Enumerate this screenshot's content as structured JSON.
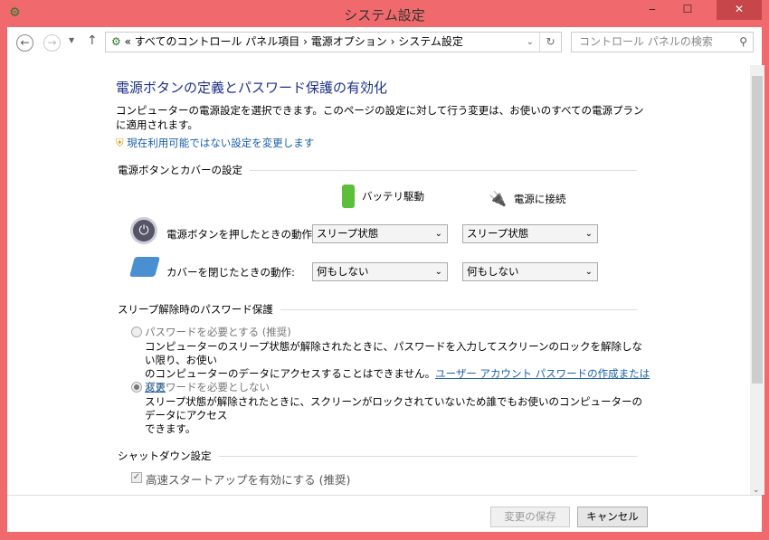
{
  "window": {
    "title": "システム設定",
    "minimize": "‒",
    "maximize": "☐",
    "close": "✕"
  },
  "nav": {
    "breadcrumb_prefix": "«",
    "crumbs": [
      "すべてのコントロール パネル項目",
      "電源オプション",
      "システム設定"
    ],
    "sep": "›",
    "search_placeholder": "コントロール パネルの検索"
  },
  "main": {
    "heading": "電源ボタンの定義とパスワード保護の有効化",
    "description": "コンピューターの電源設定を選択できます。このページの設定に対して行う変更は、お使いのすべての電源プランに適用されます。",
    "admin_link": "現在利用可能ではない設定を変更します",
    "section_power": "電源ボタンとカバーの設定",
    "col_battery": "バッテリ駆動",
    "col_plugged": "電源に接続",
    "rows": [
      {
        "label": "電源ボタンを押したときの動作:",
        "battery": "スリープ状態",
        "plugged": "スリープ状態"
      },
      {
        "label": "カバーを閉じたときの動作:",
        "battery": "何もしない",
        "plugged": "何もしない"
      }
    ],
    "section_password": "スリープ解除時のパスワード保護",
    "opt_require": "パスワードを必要とする (推奨)",
    "opt_require_desc1": "コンピューターのスリープ状態が解除されたときに、パスワードを入力してスクリーンのロックを解除しない限り、お使い",
    "opt_require_desc2": "のコンピューターのデータにアクセスすることはできません。",
    "opt_require_link": "ユーザー アカウント パスワードの作成または変更",
    "opt_norequire": "パスワードを必要としない",
    "opt_norequire_desc1": "スリープ状態が解除されたときに、スクリーンがロックされていないため誰でもお使いのコンピューターのデータにアクセス",
    "opt_norequire_desc2": "できます。",
    "section_shutdown": "シャットダウン設定",
    "fast_startup": "高速スタートアップを有効にする (推奨)"
  },
  "footer": {
    "save": "変更の保存",
    "cancel": "キャンセル"
  }
}
